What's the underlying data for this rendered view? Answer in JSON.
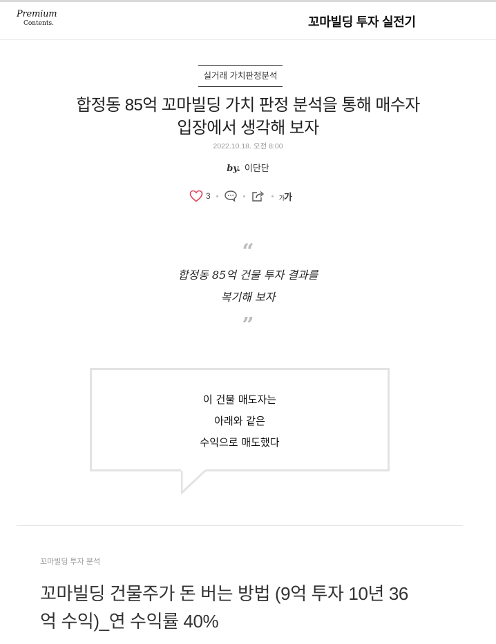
{
  "header": {
    "logo_line1": "Premium",
    "logo_line2": "Contents.",
    "title": "꼬마빌딩 투자 실전기"
  },
  "article": {
    "category": "실거래 가치판정분석",
    "title_line1": "합정동 85억 꼬마빌딩 가치 판정 분석을 통해 매수자",
    "title_line2": "입장에서 생각해 보자",
    "date": "2022.10.18. 오전 8:00",
    "byline_prefix": "by.",
    "author": "이단단"
  },
  "actions": {
    "like_count": "3",
    "font_size_label": "가",
    "font_size_small": "가"
  },
  "quote": {
    "open_mark": "“",
    "line1": "합정동 85억 건물 투자 결과를",
    "line2": "복기해 보자",
    "close_mark": "”"
  },
  "speech_box": {
    "line1": "이 건물 매도자는",
    "line2": "아래와 같은",
    "line3": "수익으로 매도했다"
  },
  "next_post": {
    "series": "꼬마빌딩 투자 분석",
    "title_line1": "꼬마빌딩 건물주가 돈 버는 방법 (9억 투자 10년 36",
    "title_line2": "억 수익)_연 수익률 40%"
  },
  "icons": {
    "like": "heart-icon",
    "comment": "comment-icon",
    "share": "share-icon"
  },
  "colors": {
    "like_heart": "#e0445c",
    "border": "#e3e3e3",
    "muted_text": "#999999"
  }
}
